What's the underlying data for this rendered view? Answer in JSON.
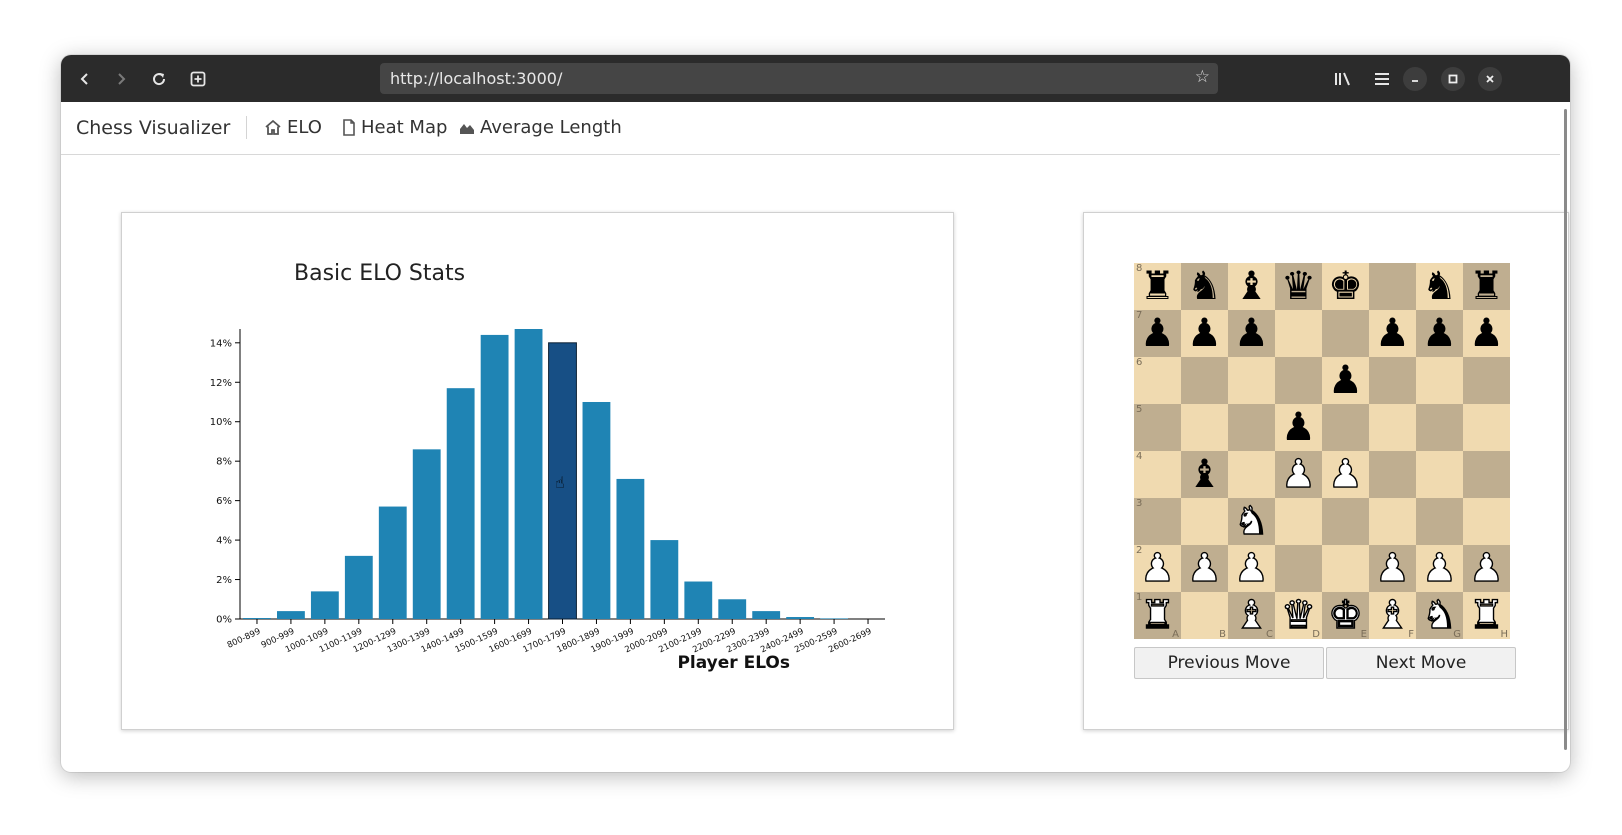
{
  "browser": {
    "url": "http://localhost:3000/"
  },
  "nav": {
    "brand": "Chess Visualizer",
    "items": [
      {
        "label": "ELO",
        "icon": "home-icon"
      },
      {
        "label": "Heat Map",
        "icon": "document-icon"
      },
      {
        "label": "Average Length",
        "icon": "area-chart-icon"
      }
    ]
  },
  "chart": {
    "title": "Basic ELO Stats"
  },
  "chart_data": {
    "type": "bar",
    "title": "Basic ELO Stats",
    "xlabel": "Player ELOs",
    "ylabel": "",
    "ylim": [
      0,
      14.7
    ],
    "yticks": [
      "0%",
      "2%",
      "4%",
      "6%",
      "8%",
      "10%",
      "12%",
      "14%"
    ],
    "categories": [
      "800-899",
      "900-999",
      "1000-1099",
      "1100-1199",
      "1200-1299",
      "1300-1399",
      "1400-1499",
      "1500-1599",
      "1600-1699",
      "1700-1799",
      "1800-1899",
      "1900-1999",
      "2000-2099",
      "2100-2199",
      "2200-2299",
      "2300-2399",
      "2400-2499",
      "2500-2599",
      "2600-2699"
    ],
    "values": [
      0.05,
      0.4,
      1.4,
      3.2,
      5.7,
      8.6,
      11.7,
      14.4,
      14.7,
      14.0,
      11.0,
      7.1,
      4.0,
      1.9,
      1.0,
      0.4,
      0.1,
      0.03,
      0.0
    ],
    "highlighted": "1700-1799",
    "colors": {
      "bar": "#1f84b4",
      "highlight": "#174f85",
      "axis": "#000000"
    },
    "grid": false
  },
  "board": {
    "ranks": [
      "8",
      "7",
      "6",
      "5",
      "4",
      "3",
      "2",
      "1"
    ],
    "files": [
      "A",
      "B",
      "C",
      "D",
      "E",
      "F",
      "G",
      "H"
    ],
    "rows": [
      [
        "br",
        "bn",
        "bb",
        "bq",
        "bk",
        "",
        "bn",
        "br"
      ],
      [
        "bp",
        "bp",
        "bp",
        "",
        "",
        "bp",
        "bp",
        "bp"
      ],
      [
        "",
        "",
        "",
        "",
        "bp",
        "",
        "",
        ""
      ],
      [
        "",
        "",
        "",
        "bp",
        "",
        "",
        "",
        ""
      ],
      [
        "",
        "bb",
        "",
        "wp",
        "wp",
        "",
        "",
        ""
      ],
      [
        "",
        "",
        "wn",
        "",
        "",
        "",
        "",
        ""
      ],
      [
        "wp",
        "wp",
        "wp",
        "",
        "",
        "wp",
        "wp",
        "wp"
      ],
      [
        "wr",
        "",
        "wb",
        "wq",
        "wk",
        "wb",
        "wn",
        "wr"
      ]
    ],
    "colors": {
      "light": "#f0dab0",
      "dark": "#bfae90"
    }
  },
  "buttons": {
    "previous": "Previous Move",
    "next": "Next Move"
  }
}
